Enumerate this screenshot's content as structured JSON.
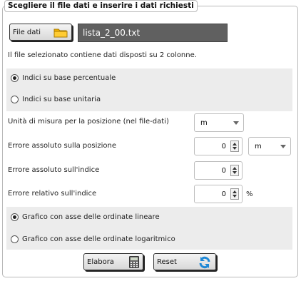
{
  "panel": {
    "title": "Scegliere il file dati e inserire i dati richiesti"
  },
  "file": {
    "button_label": "File dati",
    "filename": "lista_2_00.txt",
    "info": "Il file selezionato contiene dati disposti su 2 colonne."
  },
  "index_type": {
    "options": [
      {
        "label": "Indici su base percentuale",
        "selected": true
      },
      {
        "label": "Indici su base unitaria",
        "selected": false
      }
    ]
  },
  "fields": {
    "unit_label": "Unità di misura per la posizione (nel file-dati)",
    "unit_value": "m",
    "abs_pos_label": "Errore assoluto sulla posizione",
    "abs_pos_value": "0",
    "abs_pos_unit": "m",
    "abs_idx_label": "Errore assoluto sull'indice",
    "abs_idx_value": "0",
    "rel_idx_label": "Errore relativo sull'indice",
    "rel_idx_value": "0",
    "rel_idx_unit": "%"
  },
  "axis_type": {
    "options": [
      {
        "label": "Grafico con asse delle ordinate lineare",
        "selected": true
      },
      {
        "label": "Grafico con asse delle ordinate logaritmico",
        "selected": false
      }
    ]
  },
  "actions": {
    "process_label": "Elabora",
    "reset_label": "Reset"
  },
  "colors": {
    "folder": "#f5b400",
    "reset": "#1e88d6",
    "calculator": "#555555"
  }
}
